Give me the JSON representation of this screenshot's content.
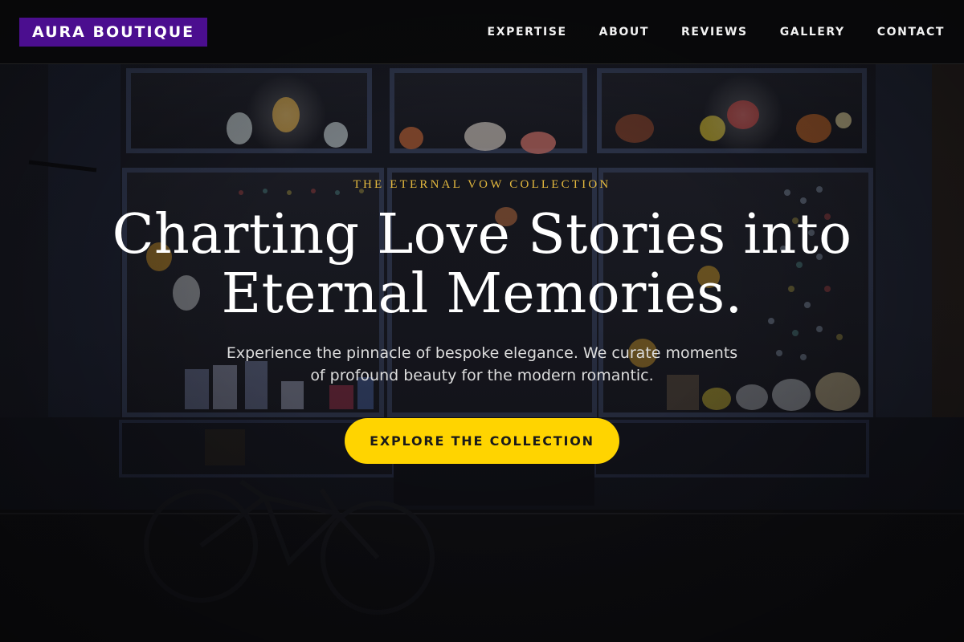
{
  "brand": {
    "name": "AURA BOUTIQUE",
    "background_color": "#4b0e8f"
  },
  "nav": {
    "items": [
      {
        "label": "EXPERTISE"
      },
      {
        "label": "ABOUT"
      },
      {
        "label": "REVIEWS"
      },
      {
        "label": "GALLERY"
      },
      {
        "label": "CONTACT"
      }
    ]
  },
  "hero": {
    "background_image": "dark-storefront-with-bicycle",
    "eyebrow": "THE ETERNAL VOW COLLECTION",
    "eyebrow_color": "#e4b93e",
    "headline_line1": "Charting Love Stories into",
    "headline_line2": "Eternal Memories.",
    "subtitle_line1": "Experience the pinnacle of bespoke elegance. We curate moments",
    "subtitle_line2": "of profound beauty for the modern romantic.",
    "cta_label": "EXPLORE THE COLLECTION",
    "cta_color": "#ffd400"
  }
}
